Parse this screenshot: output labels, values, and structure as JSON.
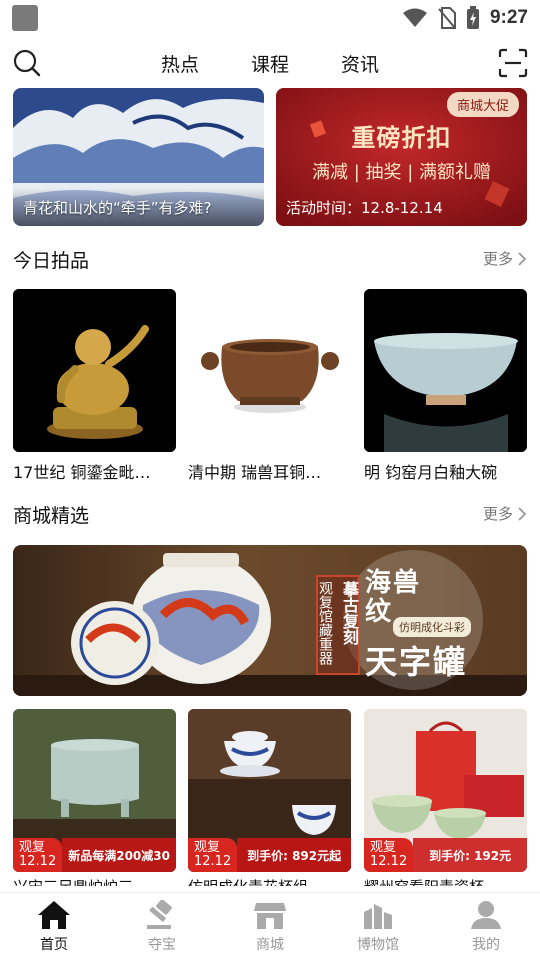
{
  "status_bar": {
    "time": "9:27"
  },
  "header": {
    "tabs": [
      "热点",
      "课程",
      "资讯"
    ]
  },
  "banners": {
    "left_caption": "青花和山水的“牵手”有多难?",
    "right_badge": "商城大促",
    "right_title": "重磅折扣",
    "right_subtitle": "满减 | 抽奖 | 满额礼赠",
    "right_date": "活动时间：12.8-12.14"
  },
  "auction_section": {
    "title": "今日拍品",
    "more": "更多",
    "items": [
      {
        "name": "17世纪 铜鎏金毗…"
      },
      {
        "name": "清中期 瑞兽耳铜…"
      },
      {
        "name": "明 钧窑月白釉大碗"
      }
    ]
  },
  "mall_section": {
    "title": "商城精选",
    "more": "更多",
    "banner": {
      "vertical_1": "观复馆藏重器",
      "vertical_2": "摹古复刻",
      "title_1": "海兽纹",
      "title_sub": "仿明成化斗彩",
      "title_2": "天字罐"
    },
    "products": [
      {
        "tag_brand": "观复",
        "tag_date": "12.12",
        "tag_text": "新品每满200减30",
        "name": "兴宋三足鼎炉炉三"
      },
      {
        "tag_brand": "观复",
        "tag_date": "12.12",
        "tag_text": "到手价: 892元起",
        "name": "仿明成化青花杯组"
      },
      {
        "tag_brand": "观复",
        "tag_date": "12.12",
        "tag_text": "到手价: 192元",
        "name": "耀州窑看阳青瓷杯"
      }
    ]
  },
  "bottom_nav": [
    {
      "label": "首页",
      "icon": "home-icon",
      "active": true
    },
    {
      "label": "夺宝",
      "icon": "gavel-icon",
      "active": false
    },
    {
      "label": "商城",
      "icon": "store-icon",
      "active": false
    },
    {
      "label": "博物馆",
      "icon": "museum-icon",
      "active": false
    },
    {
      "label": "我的",
      "icon": "user-icon",
      "active": false
    }
  ],
  "colors": {
    "accent": "#d7261f",
    "promo_bg": "#a8191b"
  }
}
